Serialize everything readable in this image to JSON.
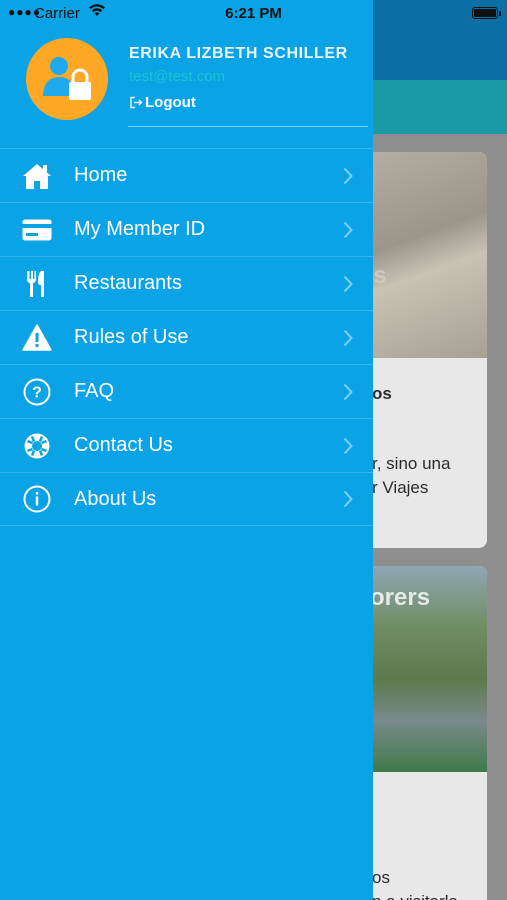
{
  "status_bar": {
    "carrier": "Carrier",
    "time": "6:21 PM"
  },
  "user": {
    "name": "ERIKA LIZBETH SCHILLER",
    "email": "test@test.com",
    "logout_label": "Logout"
  },
  "menu": {
    "items": [
      {
        "label": "Home",
        "icon": "home-icon"
      },
      {
        "label": "My Member ID",
        "icon": "id-card-icon"
      },
      {
        "label": "Restaurants",
        "icon": "utensils-icon"
      },
      {
        "label": "Rules of Use",
        "icon": "warning-icon"
      },
      {
        "label": "FAQ",
        "icon": "question-circle-icon"
      },
      {
        "label": "Contact Us",
        "icon": "life-ring-icon"
      },
      {
        "label": "About Us",
        "icon": "info-circle-icon"
      }
    ]
  },
  "background": {
    "card1": {
      "logo": "rs",
      "lines": [
        "os",
        "r, sino una",
        "r Viajes"
      ]
    },
    "card2": {
      "logo": "orers",
      "lines": [
        "os",
        "n a visitarla"
      ]
    }
  },
  "colors": {
    "menu_bg": "#0aa3e6",
    "avatar_bg": "#ffa826",
    "email": "#19c3d0",
    "nav_bar": "#0a6fa5"
  }
}
